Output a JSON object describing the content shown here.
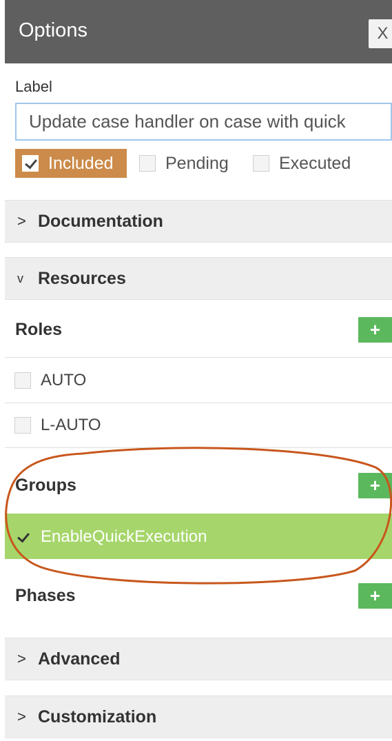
{
  "header": {
    "title": "Options",
    "close_label": "X"
  },
  "label_field": {
    "title": "Label",
    "value": "Update case handler on case with quick"
  },
  "status": {
    "included": {
      "label": "Included",
      "checked": true
    },
    "pending": {
      "label": "Pending",
      "checked": false
    },
    "executed": {
      "label": "Executed",
      "checked": false
    }
  },
  "sections": {
    "documentation": {
      "label": "Documentation",
      "expanded": false
    },
    "resources": {
      "label": "Resources",
      "expanded": true
    },
    "advanced": {
      "label": "Advanced",
      "expanded": false
    },
    "customization": {
      "label": "Customization",
      "expanded": false
    }
  },
  "roles": {
    "title": "Roles",
    "add_label": "+",
    "items": [
      {
        "label": "AUTO",
        "checked": false
      },
      {
        "label": "L-AUTO",
        "checked": false
      }
    ]
  },
  "groups": {
    "title": "Groups",
    "add_label": "+",
    "items": [
      {
        "label": "EnableQuickExecution",
        "checked": true,
        "selected": true
      }
    ]
  },
  "phases": {
    "title": "Phases",
    "add_label": "+"
  },
  "icons": {
    "collapsed": ">",
    "expanded": "v"
  },
  "colors": {
    "header_bg": "#5f5f5f",
    "included_bg": "#cc8b4a",
    "add_button": "#5cb85c",
    "selected_row": "#a6d66b",
    "annotation": "#c8561c",
    "input_border": "#9fc6ec"
  }
}
